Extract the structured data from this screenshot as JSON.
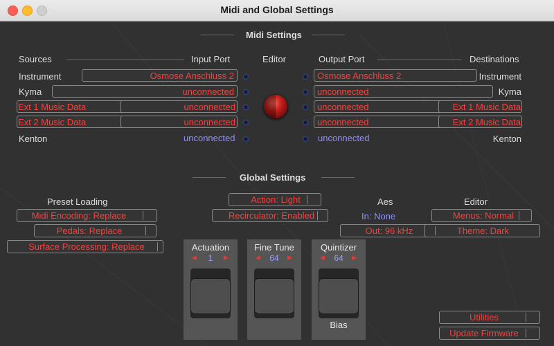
{
  "window": {
    "title": "Midi and Global Settings"
  },
  "midi": {
    "title": "Midi Settings",
    "headers": {
      "sources": "Sources",
      "input_port": "Input Port",
      "editor": "Editor",
      "output_port": "Output Port",
      "destinations": "Destinations"
    },
    "rows": [
      {
        "source": "Instrument",
        "input": "Osmose Anschluss 2",
        "output": "Osmose Anschluss 2",
        "destination": "Instrument"
      },
      {
        "source": "Kyma",
        "input": "unconnected",
        "output": "unconnected",
        "destination": "Kyma"
      },
      {
        "source": "Ext 1 Music Data",
        "input": "unconnected",
        "output": "unconnected",
        "destination": "Ext 1 Music Data"
      },
      {
        "source": "Ext 2 Music Data",
        "input": "unconnected",
        "output": "unconnected",
        "destination": "Ext 2 Music Data"
      },
      {
        "source": "Kenton",
        "input": "unconnected",
        "output": "unconnected",
        "destination": "Kenton"
      }
    ]
  },
  "global": {
    "title": "Global Settings",
    "preset_loading": {
      "label": "Preset Loading",
      "midi_encoding": "Midi Encoding: Replace",
      "pedals": "Pedals: Replace",
      "surface_processing": "Surface Processing: Replace"
    },
    "action": "Action: Light",
    "recirculator": "Recirculator: Enabled",
    "aes": {
      "label": "Aes",
      "in": "In: None",
      "out": "Out: 96 kHz"
    },
    "editor": {
      "label": "Editor",
      "menus": "Menus: Normal",
      "theme": "Theme: Dark"
    },
    "controls": [
      {
        "title": "Actuation",
        "value": "1",
        "footer": ""
      },
      {
        "title": "Fine Tune",
        "value": "64",
        "footer": ""
      },
      {
        "title": "Quintizer",
        "value": "64",
        "footer": "Bias"
      }
    ],
    "utilities": "Utilities",
    "update_firmware": "Update Firmware"
  },
  "colors": {
    "accent_red": "#f4413d",
    "value_blue": "#8e8efc",
    "background": "#313131"
  }
}
